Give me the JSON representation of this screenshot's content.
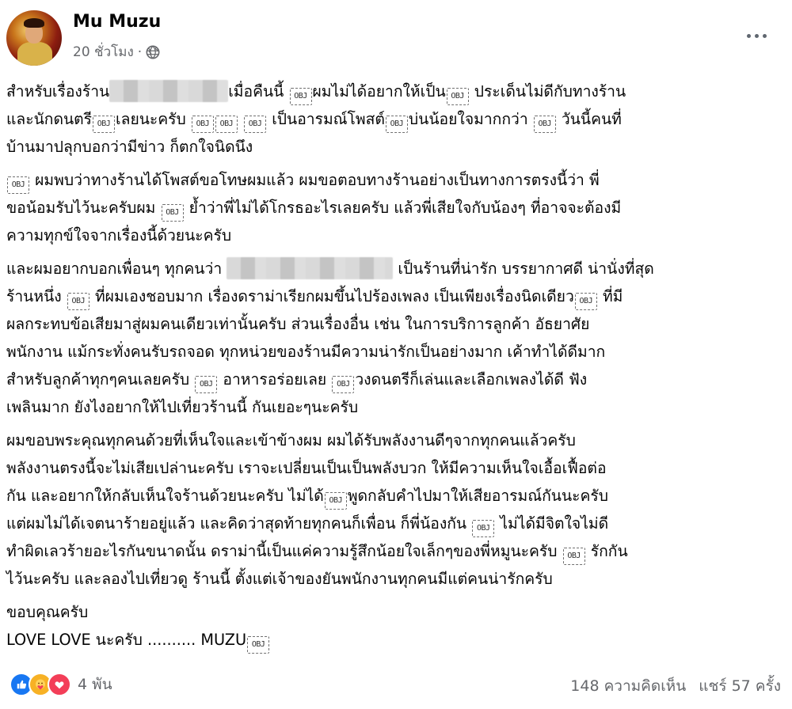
{
  "post": {
    "author": "Mu Muzu",
    "time": "20 ชั่วโมง",
    "separator": "·",
    "privacy_icon": "globe-icon",
    "menu_icon": "more-icon"
  },
  "paragraphs": [
    {
      "lines": [
        [
          "สำหรับเรื่องร้าน",
          "{blur:150}",
          "เมื่อคืนนี้ ",
          "{ob}",
          "ผมไม่ได้อยากให้เป็น",
          "{ob}",
          " ประเด็นไม่ดีกับทางร้าน"
        ],
        [
          "และนักดนตรี",
          "{ob}",
          "เลยนะครับ ",
          "{ob}",
          "{ob}",
          " ",
          "{ob}",
          " เป็นอารมณ์โพสต์",
          "{ob}",
          "บ่นน้อยใจมากกว่า ",
          "{ob}",
          "  วันนี้คนที่"
        ],
        [
          "บ้านมาปลุกบอกว่ามีข่าว  ก็ตกใจนิดนึง"
        ]
      ]
    },
    {
      "lines": [
        [
          "{ob}",
          "   ผมพบว่าทางร้านได้โพสต์ขอโทษผมแล้ว ผมขอตอบทางร้านอย่างเป็นทางการตรงนี้ว่า พี่"
        ],
        [
          "ขอน้อมรับไว้นะครับผม ",
          "{ob}",
          " ย้ำว่าพี่ไม่ได้โกรธอะไรเลยครับ แล้วพี่เสียใจกับน้องๆ ที่อาจจะต้องมี"
        ],
        [
          "ความทุกข์ใจจากเรื่องนี้ด้วยนะครับ"
        ]
      ]
    },
    {
      "lines": [
        [
          "  และผมอยากบอกเพื่อนๆ ทุกคนว่า ",
          "{blur:210}",
          "  เป็นร้านที่น่ารัก บรรยากาศดี น่านั่งที่สุด"
        ],
        [
          "ร้านหนึ่ง ",
          "{ob}",
          " ที่ผมเองชอบมาก เรื่องดราม่าเรียกผมขึ้นไปร้องเพลง เป็นเพียงเรื่องนิดเดียว",
          "{ob}",
          " ที่มี"
        ],
        [
          "ผลกระทบข้อเสียมาสู่ผมคนเดียวเท่านั้นครับ ส่วนเรื่องอื่น เช่น ในการบริการลูกค้า อัธยาศัย"
        ],
        [
          "พนักงาน แม้กระทั่งคนรับรถจอด ทุกหน่วยของร้านมีความน่ารักเป็นอย่างมาก เค้าทำได้ดีมาก"
        ],
        [
          "สำหรับลูกค้าทุกๆคนเลยครับ ",
          "{ob}",
          " อาหารอร่อยเลย  ",
          "{ob}",
          "วงดนตรีก็เล่นและเลือกเพลงได้ดี ฟัง"
        ],
        [
          "เพลินมาก ยังไงอยากให้ไปเที่ยวร้านนี้ กันเยอะๆนะครับ"
        ]
      ]
    },
    {
      "lines": [
        [
          "ผมขอบพระคุณทุกคนด้วยที่เห็นใจและเข้าข้างผม  ผมได้รับพลังงานดีๆจากทุกคนแล้วครับ"
        ],
        [
          "พลังงานตรงนี้จะไม่เสียเปล่านะครับ เราจะเปลี่ยนเป็นเป็นพลังบวก ให้มีความเห็นใจเอื้อเฟื้อต่อ"
        ],
        [
          "กัน  และอยากให้กลับเห็นใจร้านด้วยนะครับ ไม่ได้",
          "{ob}",
          "พูดกลับคำไปมาให้เสียอารมณ์กันนะครับ"
        ],
        [
          "แต่ผมไม่ได้เจตนาร้ายอยู่แล้ว  และคิดว่าสุดท้ายทุกคนก็เพื่อน ก็พี่น้องกัน ",
          "{ob}",
          " ไม่ได้มีจิตใจไม่ดี"
        ],
        [
          "ทำผิดเลวร้ายอะไรกันขนาดนั้น  ดราม่านี้เป็นแค่ความรู้สึกน้อยใจเล็กๆของพี่หมูนะครับ ",
          "{ob}",
          " รักกัน"
        ],
        [
          "ไว้นะครับ  และลองไปเที่ยวดู  ร้านนี้ ตั้งแต่เจ้าของยันพนักงานทุกคนมีแต่คนน่ารักครับ"
        ]
      ]
    },
    {
      "lines": [
        [
          "ขอบคุณครับ"
        ],
        [
          "LOVE  LOVE นะครับ ..........  MUZU",
          "{ob}"
        ]
      ]
    }
  ],
  "ob_glyph": "OBJ",
  "footer": {
    "reaction_icons": [
      "like-icon",
      "care-icon",
      "love-icon"
    ],
    "reaction_count": "4 พัน",
    "comments": "148 ความคิดเห็น",
    "shares": "แชร์ 57 ครั้ง"
  }
}
